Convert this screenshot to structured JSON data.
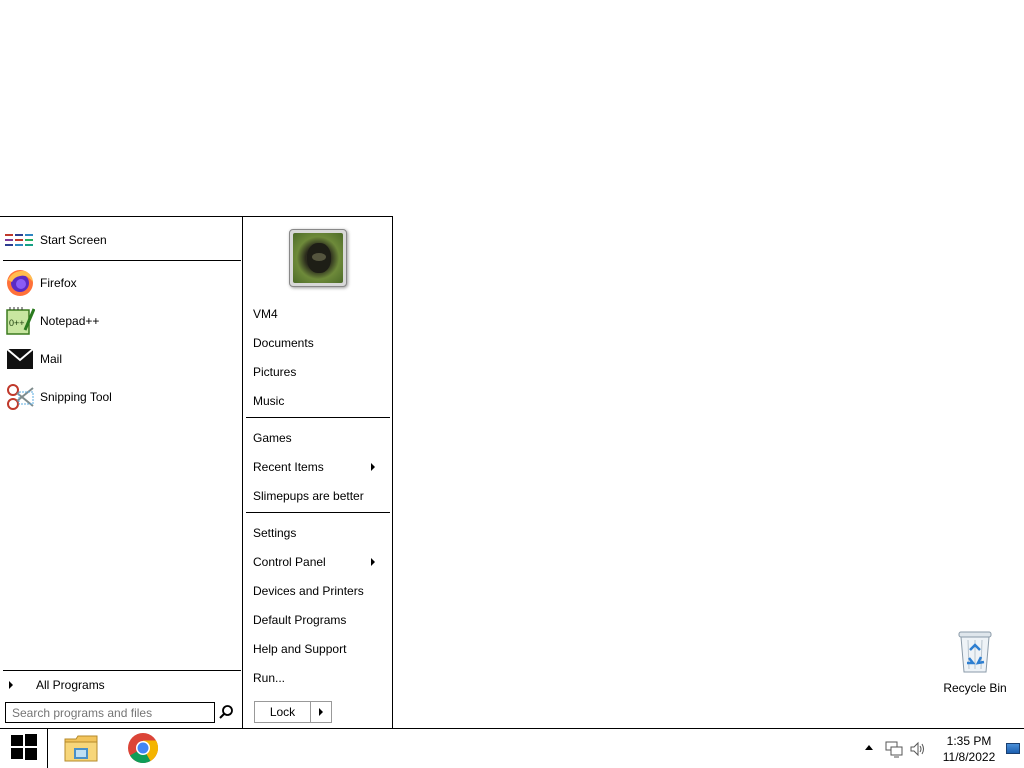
{
  "start_menu": {
    "pinned": [
      {
        "label": "Start Screen",
        "icon": "start-screen-icon"
      },
      {
        "label": "Firefox",
        "icon": "firefox-icon"
      },
      {
        "label": "Notepad++",
        "icon": "notepad-plus-plus-icon"
      },
      {
        "label": "Mail",
        "icon": "mail-icon"
      },
      {
        "label": "Snipping Tool",
        "icon": "snipping-tool-icon"
      }
    ],
    "all_programs_label": "All Programs",
    "search_placeholder": "Search programs and files",
    "right_links": [
      {
        "label": "VM4",
        "has_submenu": false
      },
      {
        "label": "Documents",
        "has_submenu": false
      },
      {
        "label": "Pictures",
        "has_submenu": false
      },
      {
        "label": "Music",
        "has_submenu": false
      },
      {
        "label": "Games",
        "has_submenu": false
      },
      {
        "label": "Recent Items",
        "has_submenu": true
      },
      {
        "label": "Slimepups are better",
        "has_submenu": false
      },
      {
        "label": "Settings",
        "has_submenu": false
      },
      {
        "label": "Control Panel",
        "has_submenu": true
      },
      {
        "label": "Devices and Printers",
        "has_submenu": false
      },
      {
        "label": "Default Programs",
        "has_submenu": false
      },
      {
        "label": "Help and Support",
        "has_submenu": false
      },
      {
        "label": "Run...",
        "has_submenu": false
      }
    ],
    "power_button_label": "Lock"
  },
  "desktop": {
    "icons": [
      {
        "label": "Recycle Bin",
        "icon": "recycle-bin-icon"
      }
    ]
  },
  "taskbar": {
    "apps": [
      {
        "name": "File Explorer",
        "icon": "file-explorer-icon"
      },
      {
        "name": "Google Chrome",
        "icon": "chrome-icon"
      }
    ],
    "tray": {
      "icons": [
        "show-hidden-icons-arrow",
        "network-icon",
        "volume-icon"
      ],
      "time": "1:35 PM",
      "date": "11/8/2022"
    }
  }
}
